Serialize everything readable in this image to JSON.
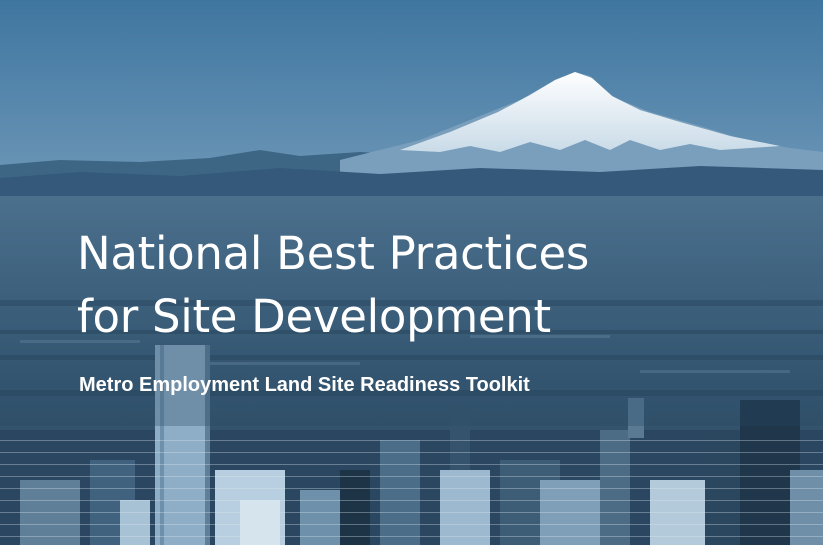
{
  "cover": {
    "title_line1": "National Best Practices",
    "title_line2": "for Site Development",
    "subtitle": "Metro Employment Land Site Readiness Toolkit",
    "image": "cityscape-with-snow-capped-mountain",
    "colors": {
      "sky": "#4a7ea6",
      "haze": "#5f88a9",
      "city": "#2c4a62",
      "title_text": "#ffffff"
    }
  }
}
